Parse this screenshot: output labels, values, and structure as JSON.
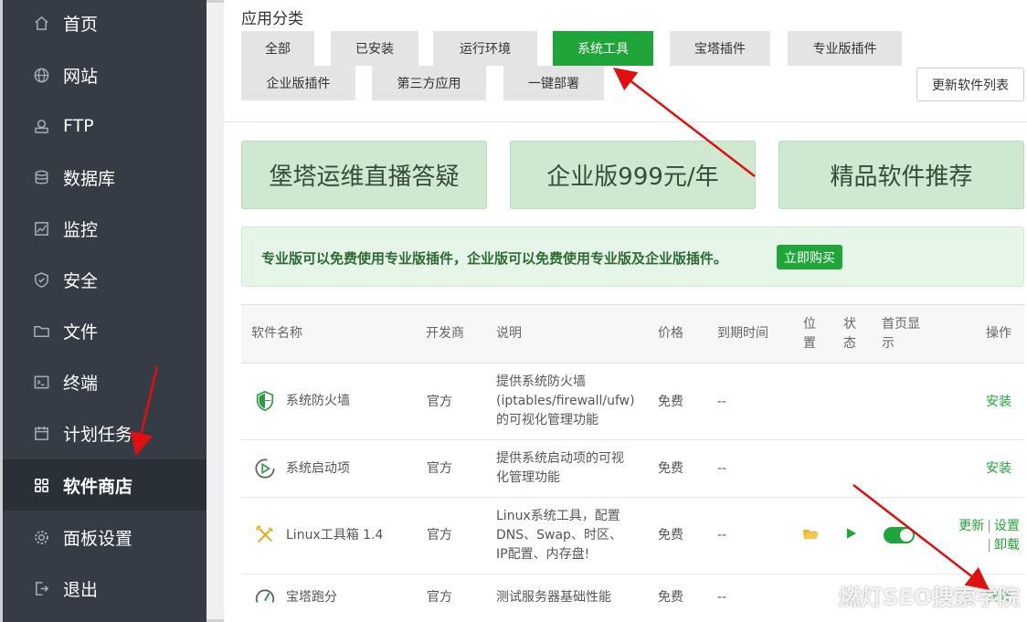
{
  "sidebar": {
    "items": [
      {
        "label": "首页",
        "icon": "home-icon"
      },
      {
        "label": "网站",
        "icon": "globe-icon"
      },
      {
        "label": "FTP",
        "icon": "ftp-icon"
      },
      {
        "label": "数据库",
        "icon": "database-icon"
      },
      {
        "label": "监控",
        "icon": "monitor-icon"
      },
      {
        "label": "安全",
        "icon": "shield-icon"
      },
      {
        "label": "文件",
        "icon": "folder-icon"
      },
      {
        "label": "终端",
        "icon": "terminal-icon"
      },
      {
        "label": "计划任务",
        "icon": "calendar-icon"
      },
      {
        "label": "软件商店",
        "icon": "apps-icon",
        "active": true
      },
      {
        "label": "面板设置",
        "icon": "gear-icon"
      },
      {
        "label": "退出",
        "icon": "logout-icon"
      }
    ]
  },
  "category": {
    "title": "应用分类",
    "tabs": [
      "全部",
      "已安装",
      "运行环境",
      "系统工具",
      "宝塔插件",
      "专业版插件",
      "企业版插件",
      "第三方应用",
      "一键部署"
    ],
    "active": "系统工具",
    "refresh_label": "更新软件列表"
  },
  "banners": [
    "堡塔运维直播答疑",
    "企业版999元/年",
    "精品软件推荐"
  ],
  "promo": {
    "text": "专业版可以免费使用专业版插件，企业版可以免费使用专业版及企业版插件。",
    "button": "立即购买"
  },
  "table": {
    "headers": {
      "name": "软件名称",
      "developer": "开发商",
      "desc": "说明",
      "price": "价格",
      "expire": "到期时间",
      "position_1": "位",
      "position_2": "置",
      "status_1": "状",
      "status_2": "态",
      "home_1": "首页显",
      "home_2": "示",
      "action": "操作"
    },
    "rows": [
      {
        "name": "系统防火墙",
        "icon": "firewall-shield-icon",
        "developer": "官方",
        "desc_lines": [
          "提供系统防火墙",
          "(iptables/firewall/ufw)",
          "的可视化管理功能"
        ],
        "price": "免费",
        "expire": "--",
        "action": "安装"
      },
      {
        "name": "系统启动项",
        "icon": "startup-icon",
        "developer": "官方",
        "desc_lines": [
          "提供系统启动项的可视",
          "化管理功能"
        ],
        "price": "免费",
        "expire": "--",
        "action": "安装"
      },
      {
        "name": "Linux工具箱 1.4",
        "icon": "toolbox-icon",
        "developer": "官方",
        "desc_lines": [
          "Linux系统工具，配置",
          "DNS、Swap、时区、",
          "IP配置、内存盘!"
        ],
        "price": "免费",
        "expire": "--",
        "position_icon": "folder-icon",
        "status_icon": "play-icon",
        "home_display_on": true,
        "actions": [
          "更新",
          "设置",
          "卸载"
        ]
      },
      {
        "name": "宝塔跑分",
        "icon": "gauge-icon",
        "developer": "官方",
        "desc_lines": [
          "测试服务器基础性能"
        ],
        "price": "免费",
        "expire": "--",
        "action": "安装"
      }
    ]
  },
  "watermark": "燃灯SEO搜索学院",
  "colors": {
    "accent": "#20a53a",
    "sidebar": "#353c45",
    "arrow": "#e01010"
  }
}
